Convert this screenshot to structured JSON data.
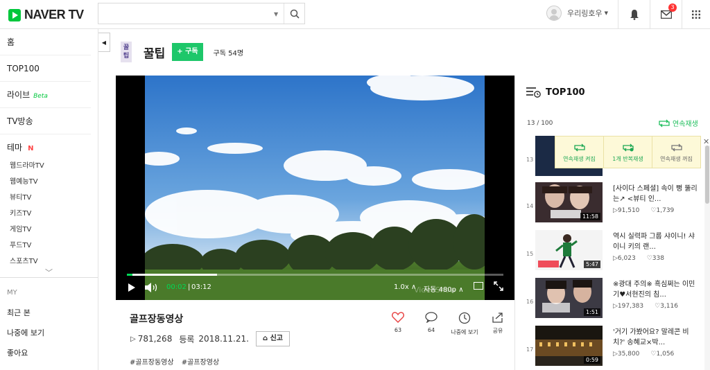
{
  "header": {
    "logo_text": "NAVER TV",
    "search": {
      "value": "",
      "placeholder": ""
    },
    "user_name": "우리링호우",
    "notification_count": "3"
  },
  "sidebar": {
    "items": [
      {
        "label": "홈"
      },
      {
        "label": "TOP100"
      },
      {
        "label": "라이브",
        "tag": "Beta"
      },
      {
        "label": "TV방송"
      },
      {
        "label": "테마",
        "tag": "N"
      }
    ],
    "sub_items": [
      "웹드라마TV",
      "웹예능TV",
      "뷰티TV",
      "키즈TV",
      "게임TV",
      "푸드TV",
      "스포츠TV"
    ],
    "my_header": "MY",
    "my_items": [
      "최근 본",
      "나중에 보기",
      "좋아요"
    ]
  },
  "channel": {
    "logo_text": "꿀팁",
    "name": "꿀팁",
    "subscribe_label": "+ 구독",
    "subscriber_count": "구독 54명"
  },
  "player": {
    "current_time": "00:02",
    "duration": "03:12",
    "speed": "1.0x",
    "quality": "자동 480p",
    "progress_fraction": 0.015,
    "buffer_fraction": 0.24,
    "watermark": "VideoShow"
  },
  "video": {
    "title": "골프장동영상",
    "views": "781,268",
    "registered_label": "등록",
    "date": "2018.11.21.",
    "report_label": "신고",
    "tags": [
      "#골프장동영상",
      "#골프장영상"
    ],
    "actions": [
      {
        "label": "63",
        "icon": "heart-icon"
      },
      {
        "label": "64",
        "icon": "comment-icon"
      },
      {
        "label": "나중에 보기",
        "icon": "clock-icon"
      },
      {
        "label": "공유",
        "icon": "share-icon"
      }
    ]
  },
  "top100": {
    "title": "TOP100",
    "position": "13 / 100",
    "continuous_label": "연속재생",
    "popup": [
      "연속재생 켜짐",
      "1개 반복재생",
      "연속재생 꺼짐"
    ],
    "items": [
      {
        "rank": "13",
        "title": "",
        "views": "",
        "likes": "",
        "duration": ""
      },
      {
        "rank": "14",
        "title": "[사이다 스페셜] 속이 뻥 뚫리는↗ <뷰티 인...",
        "views": "91,510",
        "likes": "1,739",
        "duration": "11:58"
      },
      {
        "rank": "15",
        "title": "역시 실력파 그룹 샤이니! 샤이니 키의 랜...",
        "views": "6,023",
        "likes": "338",
        "duration": "5:47"
      },
      {
        "rank": "16",
        "title": "※광대 주의※ 흑심쩌는 이민기♥서현진의 침...",
        "views": "197,383",
        "likes": "3,116",
        "duration": "1:51"
      },
      {
        "rank": "17",
        "title": "'거기 가봤어요? 말레콘 비치?' 송혜교×박...",
        "views": "35,800",
        "likes": "1,056",
        "duration": "0:59"
      }
    ]
  }
}
